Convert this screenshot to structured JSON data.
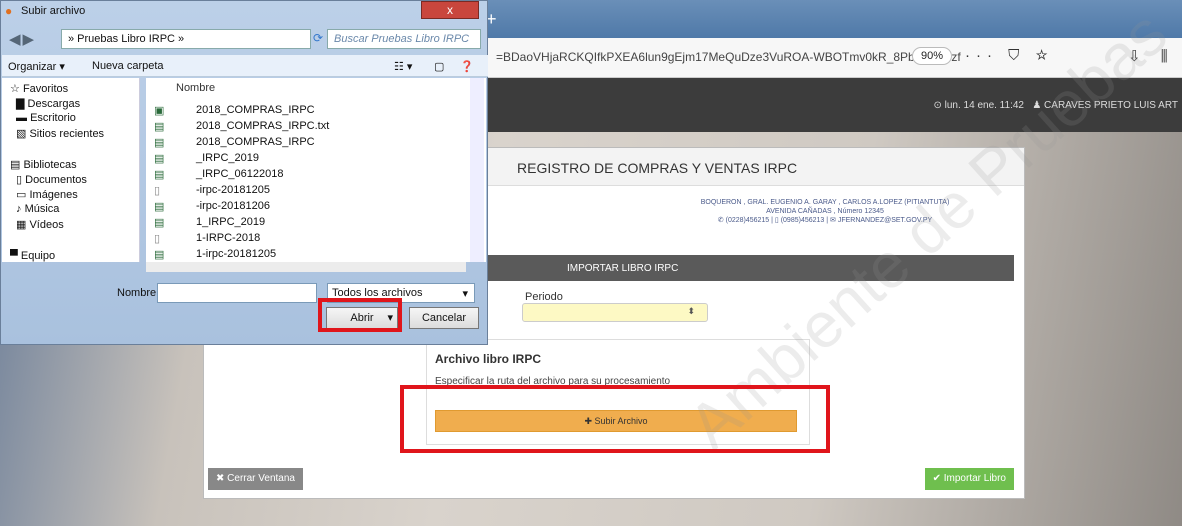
{
  "browser": {
    "tab_close": "×",
    "tab_new": "+",
    "url": "=BDaoVHjaRCKQIfkPXEA6lun9gEjm17MeQuDze3VuROA-WBOTmv0kR_8PbIm6ZOzf",
    "zoom": "90%",
    "url_icons": "··· ⛉ ☆",
    "right_icons": "⇩ ⫼"
  },
  "header": {
    "datetime": "⊙ lun. 14 ene. 11:42",
    "user": "♟ CARAVES PRIETO LUIS ART"
  },
  "modal": {
    "title": "REGISTRO DE COMPRAS Y VENTAS IRPC",
    "company_lines": [
      "BOQUERON , GRAL. EUGENIO A. GARAY , CARLOS A.LOPEZ (PITIANTUTA)",
      "AVENIDA CAÑADAS , Número 12345",
      "✆ (0228)456215 | ▯ (0985)456213 | ✉ JFERNANDEZ@SET.GOV.PY"
    ],
    "import_bar": "IMPORTAR LIBRO IRPC",
    "periodo_label": "Periodo",
    "periodo_arrow": "⬍",
    "archivo_title": "Archivo libro IRPC",
    "archivo_sub": "Especificar la ruta del archivo para su procesamiento",
    "subir_button": "✚ Subir Archivo",
    "cerrar_button": "✖ Cerrar Ventana",
    "importar_button": "✔ Importar Libro",
    "watermark": "Ambiente de Pruebas"
  },
  "dialog": {
    "title": "Subir archivo",
    "close": "x",
    "nav": "◀▶",
    "path": "» Pruebas Libro IRPC »",
    "search_placeholder": "Buscar Pruebas Libro IRPC",
    "organizar": "Organizar ▾",
    "nueva_carpeta": "Nueva carpeta",
    "left_tree": [
      {
        "icon": "☆",
        "label": "Favoritos"
      },
      {
        "icon": "▇",
        "label": "Descargas"
      },
      {
        "icon": "▬",
        "label": "Escritorio"
      },
      {
        "icon": "▧",
        "label": "Sitios recientes"
      },
      {
        "icon": "",
        "label": ""
      },
      {
        "icon": "▤",
        "label": "Bibliotecas"
      },
      {
        "icon": "▯",
        "label": "Documentos"
      },
      {
        "icon": "▭",
        "label": "Imágenes"
      },
      {
        "icon": "♪",
        "label": "Música"
      },
      {
        "icon": "▦",
        "label": "Vídeos"
      },
      {
        "icon": "",
        "label": ""
      },
      {
        "icon": "▀",
        "label": "Equipo"
      }
    ],
    "column_header": "Nombre",
    "files": [
      {
        "icon": "▣",
        "name": "2018_COMPRAS_IRPC"
      },
      {
        "icon": "▤",
        "name": "2018_COMPRAS_IRPC.txt"
      },
      {
        "icon": "▤",
        "name": "2018_COMPRAS_IRPC"
      },
      {
        "icon": "▤",
        "name": "_IRPC_2019"
      },
      {
        "icon": "▤",
        "name": "_IRPC_06122018"
      },
      {
        "icon": "▯",
        "name": "-irpc-20181205"
      },
      {
        "icon": "▤",
        "name": "-irpc-20181206"
      },
      {
        "icon": "▤",
        "name": "1_IRPC_2019"
      },
      {
        "icon": "▯",
        "name": "1-IRPC-2018"
      },
      {
        "icon": "▤",
        "name": "1-irpc-20181205"
      }
    ],
    "nombre_label": "Nombre:",
    "nombre_value": "",
    "tipo": "Todos los archivos",
    "abrir_button": "Abrir",
    "cancelar_button": "Cancelar"
  }
}
